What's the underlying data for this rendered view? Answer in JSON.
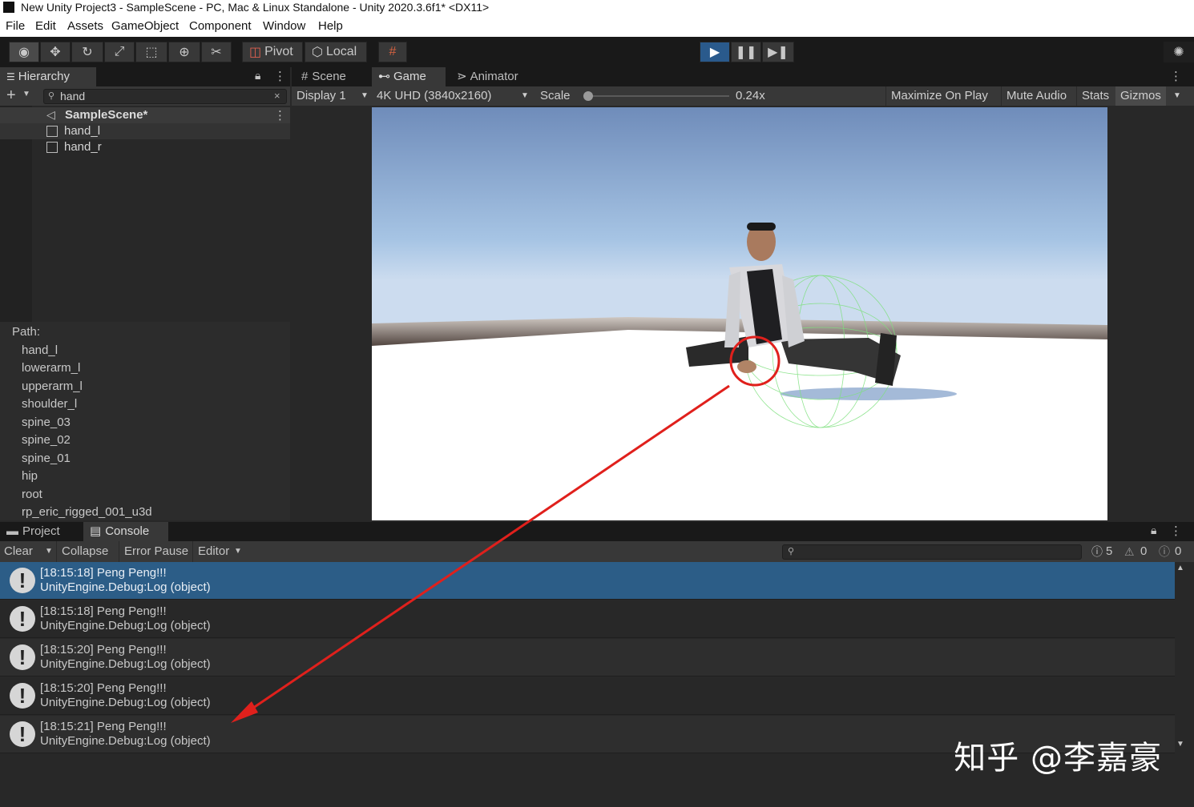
{
  "window": {
    "title": "New Unity Project3 - SampleScene - PC, Mac & Linux Standalone - Unity 2020.3.6f1* <DX11>"
  },
  "menu": [
    "File",
    "Edit",
    "Assets",
    "GameObject",
    "Component",
    "Window",
    "Help"
  ],
  "toolbar": {
    "pivot": "Pivot",
    "local": "Local"
  },
  "hierarchy": {
    "tab": "Hierarchy",
    "search_value": "hand",
    "scene": "SampleScene*",
    "items": [
      "hand_l",
      "hand_r"
    ],
    "path_label": "Path:",
    "path": [
      "hand_l",
      "lowerarm_l",
      "upperarm_l",
      "shoulder_l",
      "spine_03",
      "spine_02",
      "spine_01",
      "hip",
      "root",
      "rp_eric_rigged_001_u3d"
    ]
  },
  "game": {
    "tabs": [
      "Scene",
      "Game",
      "Animator"
    ],
    "display": "Display 1",
    "resolution": "4K UHD (3840x2160)",
    "scale_label": "Scale",
    "scale_value": "0.24x",
    "scale_level": 0.0,
    "buttons": [
      "Maximize On Play",
      "Mute Audio",
      "Stats",
      "Gizmos"
    ]
  },
  "console": {
    "tabs": [
      "Project",
      "Console"
    ],
    "toolbar": {
      "clear": "Clear",
      "collapse": "Collapse",
      "error_pause": "Error Pause",
      "editor": "Editor"
    },
    "counts": {
      "info": "5",
      "warn": "0",
      "error": "0"
    },
    "logs": [
      {
        "line1": "[18:15:18] Peng Peng!!!",
        "line2": "UnityEngine.Debug:Log (object)"
      },
      {
        "line1": "[18:15:18] Peng Peng!!!",
        "line2": "UnityEngine.Debug:Log (object)"
      },
      {
        "line1": "[18:15:20] Peng Peng!!!",
        "line2": "UnityEngine.Debug:Log (object)"
      },
      {
        "line1": "[18:15:20] Peng Peng!!!",
        "line2": "UnityEngine.Debug:Log (object)"
      },
      {
        "line1": "[18:15:21] Peng Peng!!!",
        "line2": "UnityEngine.Debug:Log (object)"
      }
    ]
  },
  "watermark": "知乎 @李嘉豪",
  "colors": {
    "annotation": "#e0201c",
    "selection": "#2c5d87",
    "collider": "#7ee07e"
  }
}
